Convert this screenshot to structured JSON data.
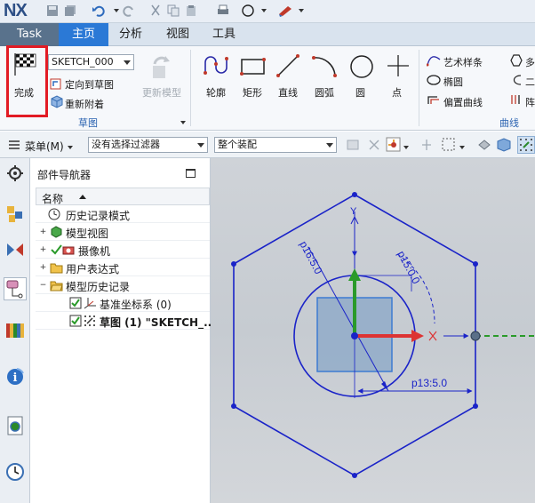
{
  "app": {
    "logo": "NX"
  },
  "tabs": [
    "Task",
    "主页",
    "分析",
    "视图",
    "工具"
  ],
  "ribbon": {
    "finish_label": "完成",
    "sketch_name": "SKETCH_000",
    "orient_to_sketch": "定向到草图",
    "reattach": "重新附着",
    "update_model": "更新模型",
    "sketch_group": "草图",
    "curves": [
      "轮廓",
      "矩形",
      "直线",
      "圆弧",
      "圆",
      "点"
    ],
    "curve_list": [
      "艺术样条",
      "椭圆",
      "偏置曲线"
    ],
    "curve_list_cut": [
      "多",
      "二",
      "阵"
    ],
    "curve_group": "曲线"
  },
  "toolbar": {
    "menu_label": "菜单(M)",
    "filter_value": "没有选择过滤器",
    "assembly_value": "整个装配"
  },
  "navigator": {
    "title": "部件导航器",
    "column_name": "名称",
    "rows": [
      {
        "label": "历史记录模式"
      },
      {
        "label": "模型视图"
      },
      {
        "label": "摄像机"
      },
      {
        "label": "用户表达式"
      },
      {
        "label": "模型历史记录"
      },
      {
        "label": "基准坐标系 (0)"
      },
      {
        "label": "草图 (1) \"SKETCH_..."
      }
    ]
  },
  "sketch": {
    "dim_diameter": "p16:5.0",
    "dim_angle": "p15:0.0",
    "dim_horizontal": "p13:5.0",
    "axis_y": "Y"
  },
  "colors": {
    "task_tab": "#59728c",
    "home_tab": "#2b79d6",
    "sketch_curve": "#1a23c8",
    "highlight": "#e21b24"
  }
}
